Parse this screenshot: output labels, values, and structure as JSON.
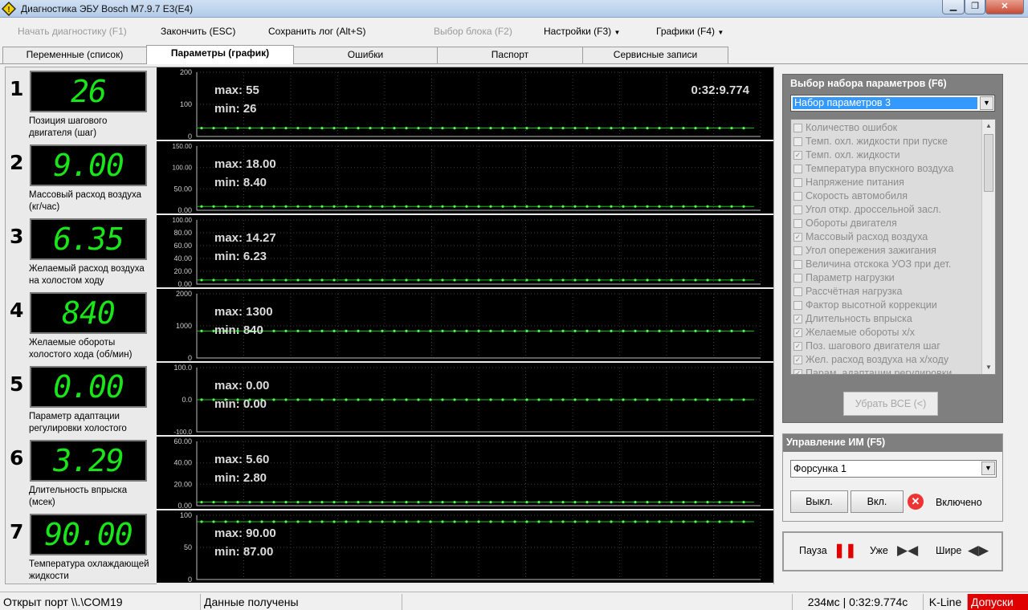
{
  "window": {
    "title": "Диагностика ЭБУ Bosch M7.9.7 E3(E4)",
    "icon": "diamond-warning-icon",
    "minimize": "▁",
    "maximize": "❐",
    "close": "✕"
  },
  "menu": {
    "start_diag": "Начать диагностику (F1)",
    "finish": "Закончить (ESC)",
    "save_log": "Сохранить лог (Alt+S)",
    "select_block": "Выбор блока (F2)",
    "settings": "Настройки (F3)",
    "graphs": "Графики (F4)"
  },
  "tabs": [
    "Переменные (список)",
    "Параметры (график)",
    "Ошибки",
    "Паспорт",
    "Сервисные записи"
  ],
  "active_tab": 1,
  "colors": {
    "lcd_digits": "#19e619",
    "graph_line": "#17c417",
    "graph_point": "#4cff4c",
    "graph_bg": "#000000",
    "access_badge": "#e00000"
  },
  "params": [
    {
      "num": "1",
      "value": "26",
      "name": "Позиция шагового двигателя (шаг)",
      "max": "max: 55",
      "min": "min: 26",
      "ticks": [
        "200",
        "100",
        "0"
      ],
      "ymin": 0,
      "ymax": 200,
      "level": 26,
      "time": "0:32:9.774"
    },
    {
      "num": "2",
      "value": "9.00",
      "name": "Массовый расход воздуха (кг/час)",
      "max": "max: 18.00",
      "min": "min: 8.40",
      "ticks": [
        "150.00",
        "100.00",
        "50.00",
        "0.00"
      ],
      "ymin": 0,
      "ymax": 150,
      "level": 9.0
    },
    {
      "num": "3",
      "value": "6.35",
      "name": "Желаемый расход воздуха на холостом ходу",
      "max": "max: 14.27",
      "min": "min: 6.23",
      "ticks": [
        "100.00",
        "80.00",
        "60.00",
        "40.00",
        "20.00",
        "0.00"
      ],
      "ymin": 0,
      "ymax": 100,
      "level": 6.35
    },
    {
      "num": "4",
      "value": "840",
      "name": "Желаемые обороты холостого хода (об/мин)",
      "max": "max: 1300",
      "min": "min: 840",
      "ticks": [
        "2000",
        "1000",
        "0"
      ],
      "ymin": 0,
      "ymax": 2000,
      "level": 840
    },
    {
      "num": "5",
      "value": "0.00",
      "name": "Параметр адаптации регулировки холостого",
      "max": "max: 0.00",
      "min": "min: 0.00",
      "ticks": [
        "100.0",
        "0.0",
        "-100.0"
      ],
      "ymin": -100,
      "ymax": 100,
      "level": 0
    },
    {
      "num": "6",
      "value": "3.29",
      "name": "Длительность впрыска (мсек)",
      "max": "max: 5.60",
      "min": "min: 2.80",
      "ticks": [
        "60.00",
        "40.00",
        "20.00",
        "0.00"
      ],
      "ymin": 0,
      "ymax": 60,
      "level": 3.29
    },
    {
      "num": "7",
      "value": "90.00",
      "name": "Температура охлаждающей жидкости",
      "max": "max: 90.00",
      "min": "min: 87.00",
      "ticks": [
        "100",
        "50",
        "0"
      ],
      "ymin": 0,
      "ymax": 100,
      "level": 90
    }
  ],
  "param_set": {
    "title": "Выбор набора параметров (F6)",
    "selected": "Набор параметров 3",
    "items": [
      {
        "label": "Количество ошибок",
        "checked": false
      },
      {
        "label": "Темп. охл. жидкости при пуске",
        "checked": false
      },
      {
        "label": "Темп. охл. жидкости",
        "checked": true
      },
      {
        "label": "Температура впускного воздуха",
        "checked": false
      },
      {
        "label": "Напряжение питания",
        "checked": false
      },
      {
        "label": "Скорость автомобиля",
        "checked": false
      },
      {
        "label": "Угол откр. дроссельной засл.",
        "checked": false
      },
      {
        "label": "Обороты двигателя",
        "checked": false
      },
      {
        "label": "Массовый расход воздуха",
        "checked": true
      },
      {
        "label": "Угол опережения зажигания",
        "checked": false
      },
      {
        "label": "Величина отскока УОЗ при дет.",
        "checked": false
      },
      {
        "label": "Параметр нагрузки",
        "checked": false
      },
      {
        "label": "Рассчётная нагрузка",
        "checked": false
      },
      {
        "label": "Фактор высотной коррекции",
        "checked": false
      },
      {
        "label": "Длительность впрыска",
        "checked": true
      },
      {
        "label": "Желаемые обороты х/х",
        "checked": true
      },
      {
        "label": "Поз. шагового двигателя шаг",
        "checked": true
      },
      {
        "label": "Жел. расход воздуха на х/ходу",
        "checked": true
      },
      {
        "label": "Парам. адаптации регулировки",
        "checked": true
      }
    ],
    "remove_all": "Убрать ВСЕ (<)"
  },
  "im_control": {
    "title": "Управление ИМ (F5)",
    "selected": "Форсунка 1",
    "off": "Выкл.",
    "on": "Вкл.",
    "status": "Включено"
  },
  "controls": {
    "pause": "Пауза",
    "narrower": "Уже",
    "wider": "Шире"
  },
  "status": {
    "port": "Открыт порт \\\\.\\COM19",
    "data": "Данные получены",
    "timing": "234мс | 0:32:9.774с",
    "protocol": "K-Line",
    "access": "Допуски"
  }
}
